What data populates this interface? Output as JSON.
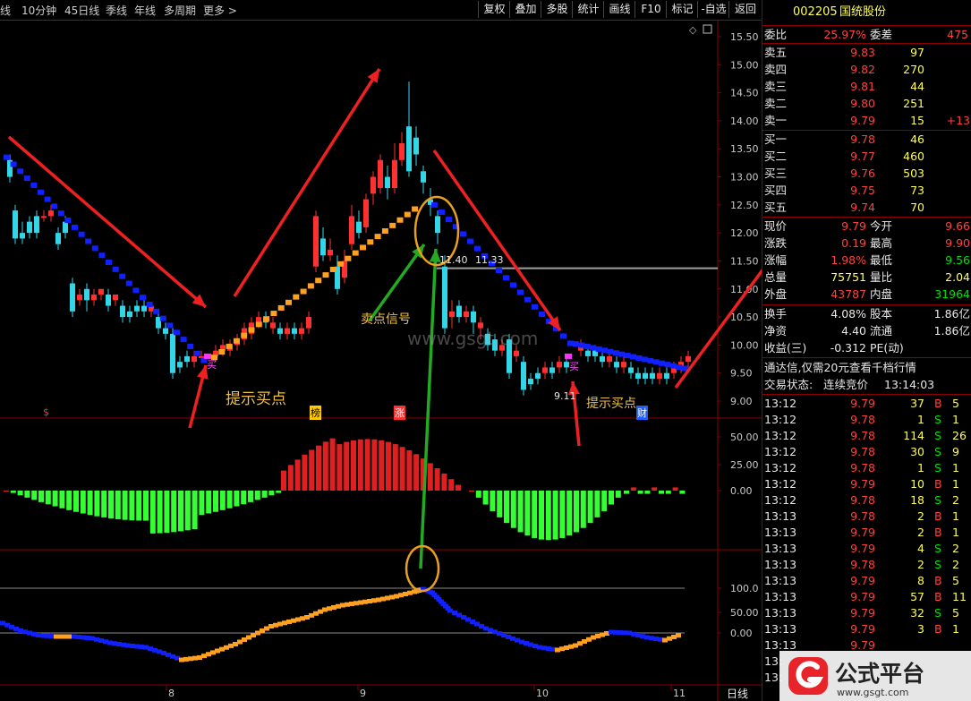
{
  "toolbar": {
    "period_tabs": [
      "线",
      "10分钟",
      "45日线",
      "季线",
      "年线",
      "多周期",
      "更多 >"
    ],
    "buttons": [
      "复权",
      "叠加",
      "多股",
      "统计",
      "画线",
      "F10",
      "标记",
      "-自选",
      "返回"
    ]
  },
  "chart": {
    "price_axis": [
      "15.50",
      "15.00",
      "14.50",
      "14.00",
      "13.50",
      "13.00",
      "12.50",
      "12.00",
      "11.50",
      "11.00",
      "10.50",
      "10.00",
      "9.50",
      "9.00"
    ],
    "macd_axis": [
      "50.00",
      "25.00",
      "0.00"
    ],
    "osc_axis": [
      "100.0",
      "50.00",
      "0.00"
    ],
    "date_labels": [
      "8",
      "9",
      "10",
      "11"
    ],
    "period_label": "日线",
    "annotations": {
      "buy_hint_1": "提示买点",
      "buy_hint_2": "提示买点",
      "sell_signal": "卖点信号",
      "buy_mark": "买",
      "sell_mark": "卖",
      "price_label_top": "11.40",
      "price_label_top2": "11.33",
      "price_label_low": "9.11",
      "marker_s": "$",
      "marker_bang": "榜",
      "marker_zhang": "涨",
      "marker_cai": "财",
      "watermark_url": "www.gsgt.com"
    },
    "colors": {
      "up": "#ff3030",
      "down": "#33d6e6",
      "trend_up": "#ffa020",
      "trend_down": "#1020ff",
      "macd_up": "#e02020",
      "macd_down": "#33ff33"
    }
  },
  "quote": {
    "code": "002205",
    "name": "国统股份",
    "weibi_label": "委比",
    "weibi": "25.97%",
    "weicha_label": "委差",
    "weicha": "475",
    "asks": [
      {
        "label": "卖五",
        "price": "9.83",
        "vol": "97",
        "chg": ""
      },
      {
        "label": "卖四",
        "price": "9.82",
        "vol": "270",
        "chg": ""
      },
      {
        "label": "卖三",
        "price": "9.81",
        "vol": "44",
        "chg": ""
      },
      {
        "label": "卖二",
        "price": "9.80",
        "vol": "251",
        "chg": ""
      },
      {
        "label": "卖一",
        "price": "9.79",
        "vol": "15",
        "chg": "+13"
      }
    ],
    "bids": [
      {
        "label": "买一",
        "price": "9.78",
        "vol": "46"
      },
      {
        "label": "买二",
        "price": "9.77",
        "vol": "460"
      },
      {
        "label": "买三",
        "price": "9.76",
        "vol": "503"
      },
      {
        "label": "买四",
        "price": "9.75",
        "vol": "73"
      },
      {
        "label": "买五",
        "price": "9.74",
        "vol": "70"
      }
    ],
    "stats": [
      {
        "l1": "现价",
        "v1": "9.79",
        "l2": "今开",
        "v2": "9.66"
      },
      {
        "l1": "涨跌",
        "v1": "0.19",
        "l2": "最高",
        "v2": "9.90"
      },
      {
        "l1": "涨幅",
        "v1": "1.98%",
        "l2": "最低",
        "v2": "9.56"
      },
      {
        "l1": "总量",
        "v1": "75751",
        "l2": "量比",
        "v2": "2.04"
      },
      {
        "l1": "外盘",
        "v1": "43787",
        "l2": "内盘",
        "v2": "31964"
      }
    ],
    "stats2": [
      {
        "l1": "换手",
        "v1": "4.08%",
        "l2": "股本",
        "v2": "1.86亿"
      },
      {
        "l1": "净资",
        "v1": "4.40",
        "l2": "流通",
        "v2": "1.86亿"
      },
      {
        "l1": "收益(三)",
        "v1": "-0.312",
        "l2": "PE(动)",
        "v2": ""
      }
    ],
    "notice": "通达信,仅需20元查看千档行情",
    "status_label": "交易状态:",
    "status_value": "连续竞价",
    "status_time": "13:14:03",
    "ticks": [
      {
        "t": "13:12",
        "p": "9.79",
        "v": "37",
        "d": "B",
        "n": "5"
      },
      {
        "t": "13:12",
        "p": "9.78",
        "v": "1",
        "d": "S",
        "n": "1"
      },
      {
        "t": "13:12",
        "p": "9.78",
        "v": "114",
        "d": "S",
        "n": "26"
      },
      {
        "t": "13:12",
        "p": "9.78",
        "v": "30",
        "d": "S",
        "n": "9"
      },
      {
        "t": "13:12",
        "p": "9.78",
        "v": "1",
        "d": "S",
        "n": "1"
      },
      {
        "t": "13:12",
        "p": "9.79",
        "v": "10",
        "d": "B",
        "n": "1"
      },
      {
        "t": "13:12",
        "p": "9.78",
        "v": "18",
        "d": "S",
        "n": "2"
      },
      {
        "t": "13:13",
        "p": "9.78",
        "v": "2",
        "d": "B",
        "n": "1"
      },
      {
        "t": "13:13",
        "p": "9.79",
        "v": "2",
        "d": "B",
        "n": "1"
      },
      {
        "t": "13:13",
        "p": "9.79",
        "v": "4",
        "d": "S",
        "n": "2"
      },
      {
        "t": "13:13",
        "p": "9.78",
        "v": "2",
        "d": "S",
        "n": "2"
      },
      {
        "t": "13:13",
        "p": "9.79",
        "v": "8",
        "d": "B",
        "n": "5"
      },
      {
        "t": "13:13",
        "p": "9.79",
        "v": "57",
        "d": "B",
        "n": "11"
      },
      {
        "t": "13:13",
        "p": "9.79",
        "v": "32",
        "d": "S",
        "n": "5"
      },
      {
        "t": "13:13",
        "p": "9.79",
        "v": "3",
        "d": "B",
        "n": "1"
      },
      {
        "t": "13:13",
        "p": "9.79",
        "v": "",
        "d": "",
        "n": ""
      },
      {
        "t": "13:",
        "p": "",
        "v": "",
        "d": "",
        "n": ""
      },
      {
        "t": "13:",
        "p": "",
        "v": "",
        "d": "",
        "n": ""
      }
    ]
  },
  "watermark": {
    "brand": "公式平台",
    "url": "www.gsgt.com"
  }
}
